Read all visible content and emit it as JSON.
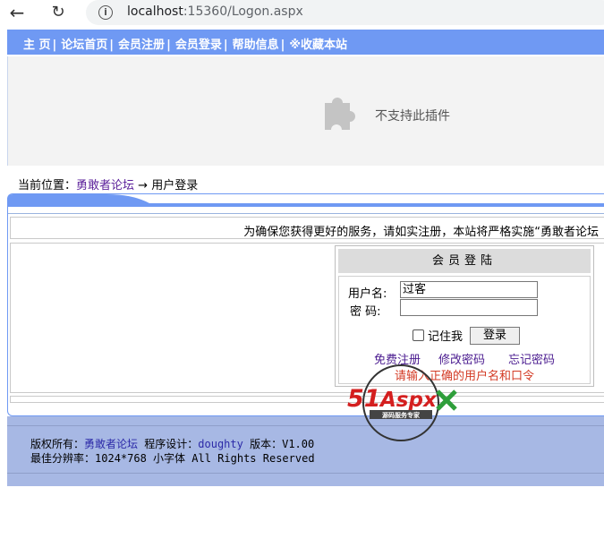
{
  "browser": {
    "url_host": "localhost",
    "url_rest": ":15360/Logon.aspx"
  },
  "topnav": {
    "items": [
      "主 页",
      "论坛首页",
      "会员注册",
      "会员登录",
      "帮助信息",
      "※收藏本站"
    ],
    "separator": "|"
  },
  "plugin": {
    "message": "不支持此插件"
  },
  "breadcrumb": {
    "prefix": "当前位置：",
    "link": "勇敢者论坛",
    "arrow": "→",
    "current": "用户登录"
  },
  "notice": "为确保您获得更好的服务，请如实注册，本站将严格实施“勇敢者论坛",
  "login": {
    "title": "会员登陆",
    "username_label": "用户名:",
    "username_value": "过客",
    "password_label": "密  码:",
    "password_value": "",
    "remember_label": "记住我",
    "submit_label": "登录",
    "link_register": "免费注册",
    "link_change_pwd": "修改密码",
    "link_forgot_pwd": "忘记密码",
    "error": "请输入正确的用户名和口令"
  },
  "footer": {
    "copyright_label": "版权所有：",
    "copyright_link": "勇敢者论坛",
    "designer_label": "程序设计：",
    "designer_link": "doughty",
    "version_label": "版本：",
    "version_value": "V1.00",
    "resolution_label": "最佳分辨率：",
    "resolution_value": "1024*768",
    "font_note": "小字体 All Rights Reserved"
  },
  "watermark": {
    "logo": "51Aspx",
    "tagline": "源码服务专家"
  },
  "colors": {
    "nav_bg": "#6f99f3",
    "footer_bg": "#a7b8e4",
    "link": "#4b1c90",
    "error": "#d33a24"
  }
}
